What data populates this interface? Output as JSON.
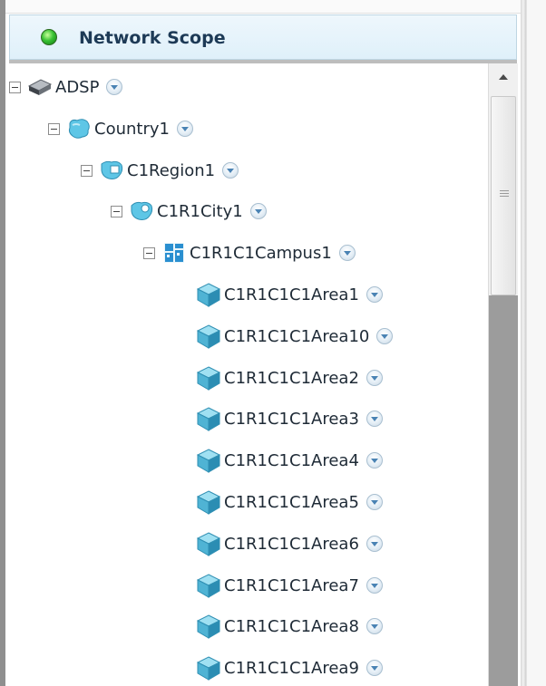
{
  "panel": {
    "title": "Network Scope"
  },
  "tree": {
    "root": "ADSP",
    "country": "Country1",
    "region": "C1Region1",
    "city": "C1R1City1",
    "campus": "C1R1C1Campus1",
    "areas": [
      "C1R1C1C1Area1",
      "C1R1C1C1Area10",
      "C1R1C1C1Area2",
      "C1R1C1C1Area3",
      "C1R1C1C1Area4",
      "C1R1C1C1Area5",
      "C1R1C1C1Area6",
      "C1R1C1C1Area7",
      "C1R1C1C1Area8",
      "C1R1C1C1Area9"
    ]
  },
  "icons": {
    "status": "status-online-icon",
    "root": "device-icon",
    "country": "country-icon",
    "region": "region-icon",
    "city": "city-icon",
    "campus": "campus-icon",
    "area": "area-cube-icon",
    "dropdown": "chevron-down-icon"
  },
  "colors": {
    "header_bg": "#dff0fa",
    "header_text": "#1d3a56",
    "status_green": "#39c234",
    "dropdown_arrow": "#4a83b4",
    "area_icon": "#4fb3d4"
  }
}
